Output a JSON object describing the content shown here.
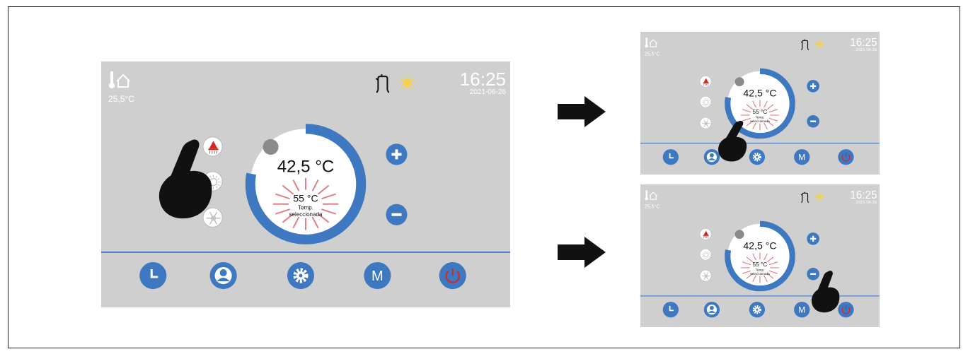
{
  "screens": [
    {
      "id": "main",
      "room_temp": "25,5°C",
      "time": "16:25",
      "date": "2021-06-26",
      "current_temp": "42,5 °C",
      "set_temp": "55 °C",
      "set_temp_label": "Temp. seleccionada",
      "gesture": "tap-heat-mode"
    },
    {
      "id": "step-1",
      "room_temp": "25,5°C",
      "time": "16:25",
      "date": "2021-06-26",
      "current_temp": "42,5 °C",
      "set_temp": "55 °C",
      "set_temp_label": "Temp. seleccionada",
      "gesture": "drag-dial"
    },
    {
      "id": "step-2",
      "room_temp": "25,5°C",
      "time": "16:25",
      "date": "2021-06-26",
      "current_temp": "42,5 °C",
      "set_temp": "55 °C",
      "set_temp_label": "Temp. seleccionada",
      "gesture": "tap-minus"
    }
  ],
  "dial_progress": 0.78,
  "icons": {
    "mode_buttons": [
      "heat-mode-icon",
      "sun-mode-icon",
      "snowflake-mode-icon"
    ],
    "side_buttons": [
      "plus-icon",
      "minus-icon"
    ],
    "nav_buttons": [
      "clock-icon",
      "user-icon",
      "gear-icon",
      "m-icon",
      "power-icon"
    ],
    "status": [
      "boiler-icon",
      "sun-icon"
    ]
  },
  "nav": {
    "m_label": "M"
  },
  "colors": {
    "panel_bg": "#cfcfcf",
    "accent_blue": "#3d78c0",
    "heat_red": "#d9251c",
    "glow_pink": "#e07f86",
    "sun_yellow": "#f2d24b"
  }
}
